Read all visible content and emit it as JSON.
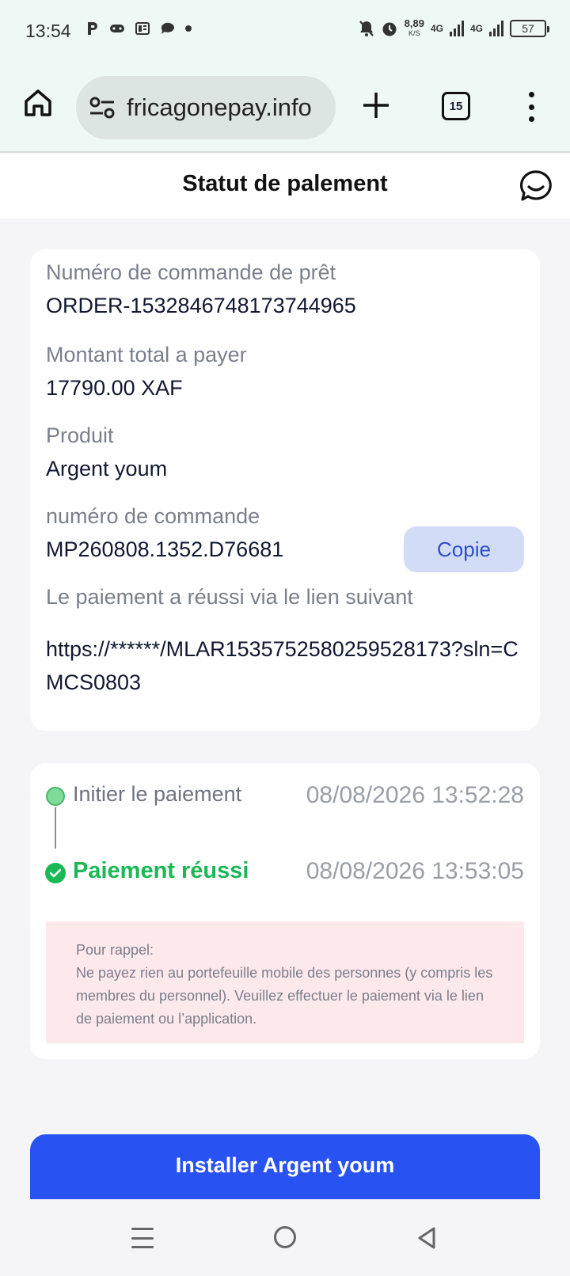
{
  "status_bar": {
    "time": "13:54",
    "speed_value": "8,89",
    "speed_unit": "K/S",
    "network_1": "4G",
    "network_2": "4G",
    "battery": "57"
  },
  "browser": {
    "url": "fricagonepay.info",
    "tab_count": "15"
  },
  "page": {
    "title": "Statut de palement"
  },
  "order_info": {
    "loan_order_label": "Numéro de commande de prêt",
    "loan_order_value": "ORDER-1532846748173744965",
    "total_label": "Montant total a payer",
    "total_value": "17790.00 XAF",
    "product_label": "Produit",
    "product_value": "Argent youm",
    "order_number_label": "numéro de commande",
    "order_number_value": "MP260808.1352.D76681",
    "copy_label": "Copie",
    "link_label": "Le paiement a réussi via le lien suivant",
    "link_value": "https://******/MLAR1535752580259528173?sln=CMCS0803"
  },
  "timeline": {
    "step1_label": "Initier le paiement",
    "step1_time": "08/08/2026 13:52:28",
    "step2_label": "Paiement réussi",
    "step2_time": "08/08/2026 13:53:05"
  },
  "reminder": {
    "title": "Pour rappel:",
    "body": "Ne payez rien au portefeuille mobile des personnes (y compris les membres du personnel). Veuillez effectuer le paiement via le lien de paiement ou l’application."
  },
  "install_button": {
    "label": "Installer Argent youm"
  },
  "colors": {
    "primary": "#2952f2",
    "success": "#1ab854",
    "reminder_bg": "#fde8ec",
    "copy_bg": "#d3dcf7"
  }
}
